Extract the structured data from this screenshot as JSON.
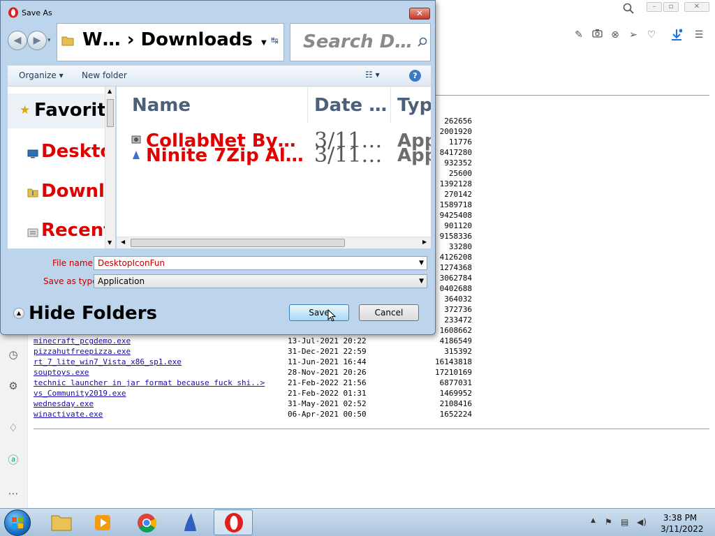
{
  "dialog": {
    "title": "Save As",
    "address_path": "W…  ›  Downloads",
    "search_placeholder": "Search D…",
    "organize": "Organize ▾",
    "new_folder": "New folder",
    "nav": {
      "favorites": "Favorite",
      "items": [
        "Deskto",
        "Downlo",
        "Recent"
      ]
    },
    "columns": [
      "Name",
      "Date …",
      "Typ"
    ],
    "files": [
      {
        "name": "CollabNet By…",
        "date": "3/11…",
        "type": "App"
      },
      {
        "name": "Ninite 7Zip Al…",
        "date": "3/11…",
        "type": "App"
      }
    ],
    "file_name_label": "File name:",
    "file_name_value": "DesktopIconFun",
    "save_type_label": "Save as type:",
    "save_type_value": "Application",
    "hide_folders": "Hide Folders",
    "save_btn": "Save",
    "cancel_btn": "Cancel"
  },
  "listing": {
    "sizes_partial": [
      "262656",
      "2001920",
      "11776",
      "8417280",
      "932352",
      "25600",
      "1392128",
      "270142",
      "1589718",
      "9425408",
      "901120",
      "9158336",
      "33280",
      "4126208",
      "1274368",
      "3062784",
      "0402688",
      "364032",
      "372736",
      "233472",
      "1608662"
    ],
    "rows": [
      {
        "name": "minecraft_pcgdemo.exe",
        "date": "13-Jul-2021 20:22",
        "size": "4186549"
      },
      {
        "name": "pizzahutfreepizza.exe",
        "date": "31-Dec-2021 22:59",
        "size": "315392"
      },
      {
        "name": "rt_7_lite_win7_Vista_x86_sp1.exe",
        "date": "11-Jun-2021 16:44",
        "size": "16143818"
      },
      {
        "name": "souptoys.exe",
        "date": "28-Nov-2021 20:26",
        "size": "17210169"
      },
      {
        "name": "technic launcher in jar format because fuck shi..>",
        "date": "21-Feb-2022 21:56",
        "size": "6877031"
      },
      {
        "name": "vs_Community2019.exe",
        "date": "21-Feb-2022 01:31",
        "size": "1469952"
      },
      {
        "name": "wednesday.exe",
        "date": "31-May-2021 02:52",
        "size": "2108416"
      },
      {
        "name": "winactivate.exe",
        "date": "06-Apr-2021 00:50",
        "size": "1652224"
      }
    ]
  },
  "taskbar": {
    "time": "3:38 PM",
    "date": "3/11/2022"
  }
}
